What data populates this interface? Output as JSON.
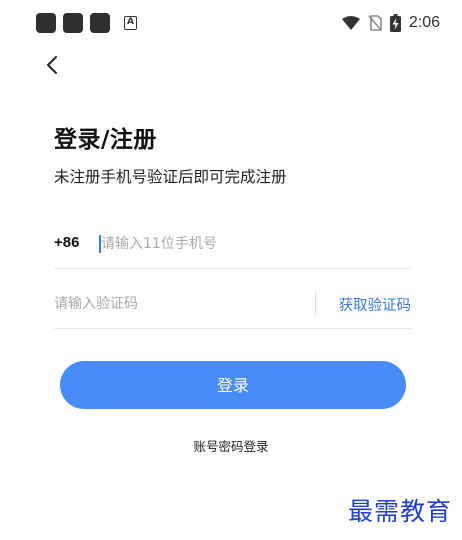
{
  "status_bar": {
    "time": "2:06",
    "notification_icons": [
      "app-icon",
      "app-icon",
      "app-icon",
      "a-icon"
    ],
    "status_icons": [
      "wifi-icon",
      "no-sim-icon",
      "battery-charging-icon"
    ]
  },
  "header": {
    "back_icon": "chevron-left-icon"
  },
  "main": {
    "title": "登录/注册",
    "subtitle": "未注册手机号验证后即可完成注册",
    "phone": {
      "country_code": "+86",
      "placeholder": "请输入11位手机号",
      "value": ""
    },
    "code": {
      "placeholder": "请输入验证码",
      "value": "",
      "get_code_label": "获取验证码"
    },
    "login_label": "登录",
    "password_login_label": "账号密码登录"
  },
  "watermark": "最需教育",
  "colors": {
    "accent": "#4a8cf7",
    "link": "#3a78e7",
    "watermark": "#1f3fd6"
  }
}
